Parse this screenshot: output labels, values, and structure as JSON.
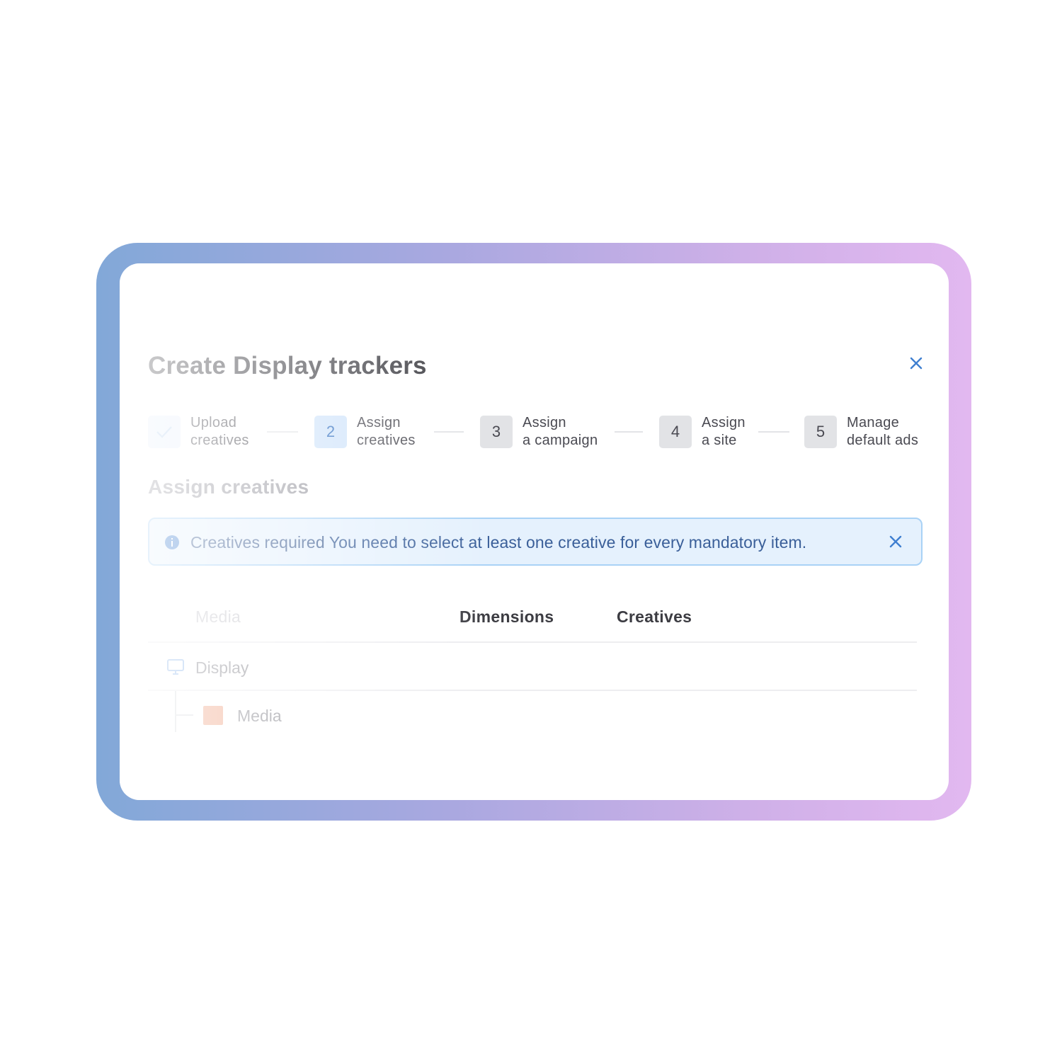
{
  "dialog": {
    "title": "Create Display trackers"
  },
  "stepper": {
    "steps": [
      {
        "number": "",
        "line1": "Upload",
        "line2": "creatives",
        "state": "done"
      },
      {
        "number": "2",
        "line1": "Assign",
        "line2": "creatives",
        "state": "active"
      },
      {
        "number": "3",
        "line1": "Assign",
        "line2": "a campaign",
        "state": "pending"
      },
      {
        "number": "4",
        "line1": "Assign",
        "line2": "a site",
        "state": "pending"
      },
      {
        "number": "5",
        "line1": "Manage",
        "line2": "default ads",
        "state": "pending"
      }
    ]
  },
  "section": {
    "title": "Assign creatives"
  },
  "alert": {
    "title": "Creatives required",
    "message": "You need to select at least one creative for every mandatory item."
  },
  "table": {
    "headers": {
      "media": "Media",
      "dimensions": "Dimensions",
      "creatives": "Creatives"
    },
    "rows": [
      {
        "label": "Display",
        "icon": "monitor-icon"
      },
      {
        "label": "Media",
        "swatch_color": "#f0a98c"
      }
    ]
  },
  "colors": {
    "accent": "#2f6dbf",
    "alert_bg": "#e5f1fd",
    "alert_border": "#a9d2f6",
    "frame_gradient_start": "#82a8d8",
    "frame_gradient_end": "#e2b8f0"
  }
}
